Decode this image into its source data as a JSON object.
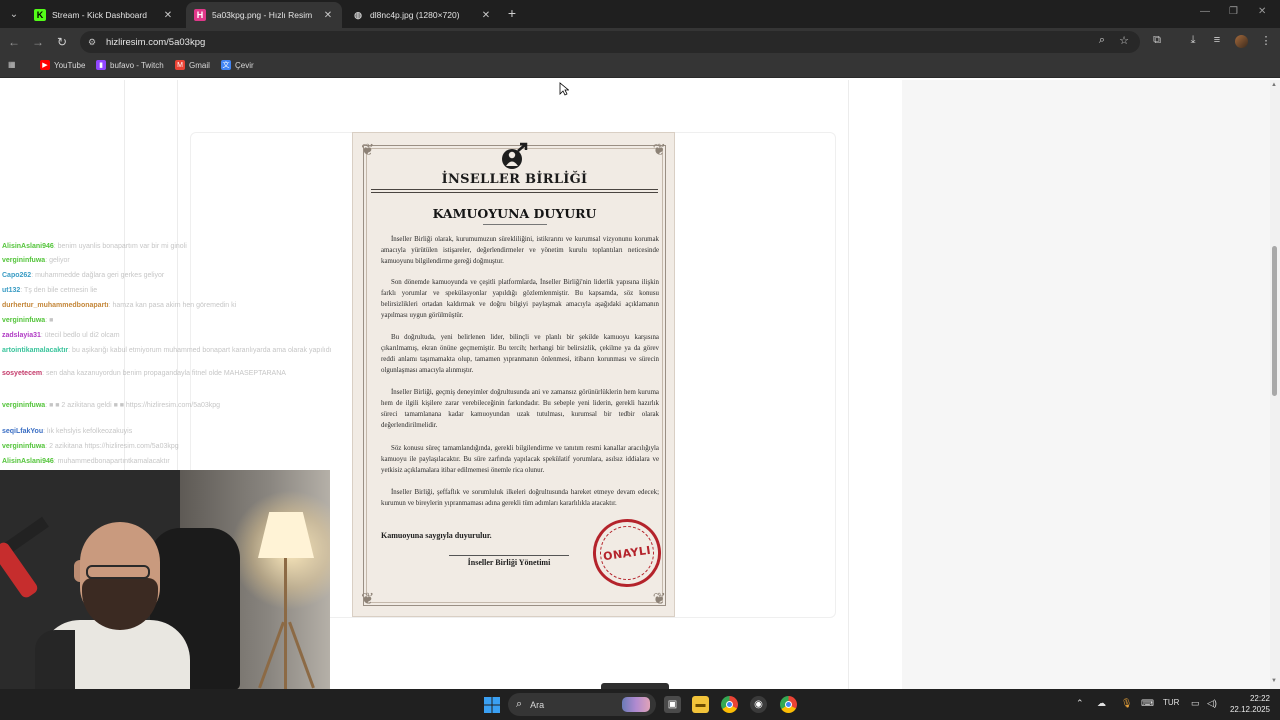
{
  "browser": {
    "tabs": [
      {
        "title": "Stream - Kick Dashboard",
        "icon": "kick-icon",
        "active": false
      },
      {
        "title": "5a03kpg.png - Hızlı Resim",
        "icon": "hizliresim-icon",
        "active": true
      },
      {
        "title": "dl8nc4p.jpg (1280×720)",
        "icon": "globe-icon",
        "active": false
      }
    ],
    "url": "hizliresim.com/5a03kpg",
    "bookmarks": [
      {
        "label": "YouTube",
        "icon": "youtube-icon",
        "color": "#ff0000"
      },
      {
        "label": "bufavo - Twitch",
        "icon": "twitch-icon",
        "color": "#9146ff"
      },
      {
        "label": "Gmail",
        "icon": "gmail-icon",
        "color": "#ea4335"
      },
      {
        "label": "Çevir",
        "icon": "translate-icon",
        "color": "#4285f4"
      }
    ]
  },
  "document": {
    "org_name": "İNSELLER BİRLİĞİ",
    "heading": "KAMUOYUNA DUYURU",
    "paragraphs": [
      "İnseller Birliği olarak, kurumumuzun sürekliliğini, istikrarını ve kurumsal vizyonunu korumak amacıyla yürütülen istişareler, değerlendirmeler ve yönetim kurulu toplantıları neticesinde kamuoyunu bilgilendirme gereği doğmuştur.",
      "Son dönemde kamuoyunda ve çeşitli platformlarda, İnseller Birliği'nin liderlik yapısına ilişkin farklı yorumlar ve spekülasyonlar yapıldığı gözlemlenmiştir. Bu kapsamda, söz konusu belirsizlikleri ortadan kaldırmak ve doğru bilgiyi paylaşmak amacıyla aşağıdaki açıklamanın yapılması uygun görülmüştür.",
      "Bu doğrultuda, yeni belirlenen lider, bilinçli ve planlı bir şekilde kamuoyu karşısına çıkarılmamış, ekran önüne geçmemiştir. Bu tercih; herhangi bir belirsizlik, çekilme ya da görev reddi anlamı taşımamakta olup, tamamen yıpranmanın önlenmesi, itibarın korunması ve sürecin olgunlaşması amacıyla alınmıştır.",
      "İnseller Birliği, geçmiş deneyimler doğrultusunda ani ve zamansız görünürlüklerin hem kuruma hem de ilgili kişilere zarar verebileceğinin farkındadır. Bu sebeple yeni liderin, gerekli hazırlık süreci tamamlanana kadar kamuoyundan uzak tutulması, kurumsal bir tedbir olarak değerlendirilmelidir.",
      "Söz konusu süreç tamamlandığında, gerekli bilgilendirme ve tanıtım resmi kanallar aracılığıyla kamuoyu ile paylaşılacaktır. Bu süre zarfında yapılacak spekülatif yorumlara, asılsız iddialara ve yetkisiz açıklamalara itibar edilmemesi önemle rica olunur.",
      "İnseller Birliği, şeffaflık ve sorumluluk ilkeleri doğrultusunda hareket etmeye devam edecek; kurumun ve bireylerin yıpranmaması adına gerekli tüm adımları kararlılıkla atacaktır."
    ],
    "greeting": "Kamuoyuna saygıyla duyurulur.",
    "signature": "İnseller Birliği Yönetimi",
    "stamp_text": "ONAYLI"
  },
  "chat": [
    {
      "user": "AlisinAslani946",
      "text": ": benim uyanlis bonapartım var bir mi ginoli",
      "color": "#53c43a"
    },
    {
      "user": "vergininfuwa",
      "text": ": geliyor",
      "color": "#53c43a"
    },
    {
      "user": "Capo262",
      "text": ": muhammedde dağlara geri gerkes geliyor",
      "color": "#3a9cc4"
    },
    {
      "user": "ut132",
      "text": ": Tş den bile cetmesin lie",
      "color": "#3a9cc4"
    },
    {
      "user": "durhertur_muhammedbonapartı",
      "text": ": hamza kan pasa akim hen göremedin ki",
      "color": "#c4873a"
    },
    {
      "user": "vergininfuwa",
      "text": ": ■",
      "color": "#53c43a"
    },
    {
      "user": "zadslayia31",
      "text": ": ütecil bedlo ul di2 olcam",
      "color": "#b03ac4"
    },
    {
      "user": "artointikamalacaktır",
      "text": ": bu aşikarığı kabul etmiyorum muhammed bonapart karanlıyarda ama olarak yapılıdı",
      "color": "#3ac49c"
    },
    {
      "user": "sosyetecem",
      "text": ": sen daha kazanuyordun benim propagandayla fitnel olde MAHASEPTARANA",
      "color": "#c43a6a"
    },
    {
      "user": "vergininfuwa",
      "text": ": ■ ■ 2 azikitana geldi ■ ■ https://hizliresim.com/5a03kpg",
      "color": "#53c43a"
    },
    {
      "user": "seqiLfakYou",
      "text": ": lık kehslyis kefolkeozakuyis",
      "color": "#3a6ec4"
    },
    {
      "user": "vergininfuwa",
      "text": ": 2 azikitana https://hizliresim.com/5a03kpg",
      "color": "#53c43a"
    },
    {
      "user": "AlisinAslani946",
      "text": ": muhammedbonapartıntkamalacaktır",
      "color": "#53c43a"
    }
  ],
  "taskbar": {
    "search_placeholder": "Ara",
    "language": "TUR",
    "time": "22:22",
    "date": "22.12.2025"
  }
}
